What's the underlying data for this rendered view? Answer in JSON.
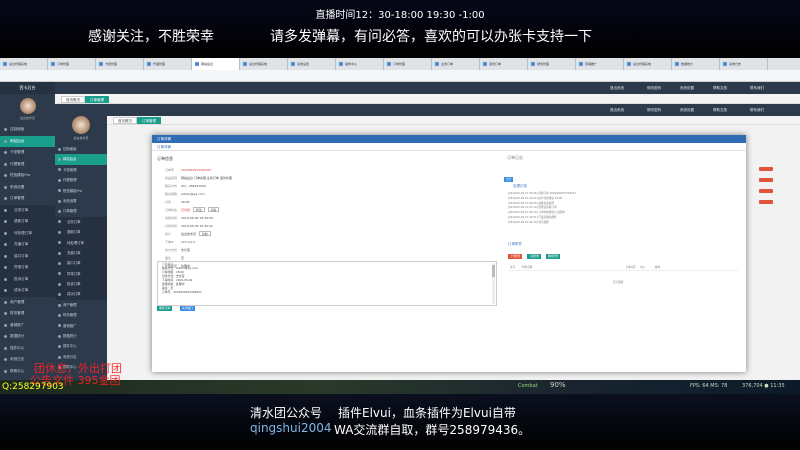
{
  "stream": {
    "live_time": "直播时间12：30-18:00   19:30 -1:00",
    "banner_left": "感谢关注，不胜荣幸",
    "banner_right": "请多发弹幕，有问必答，喜欢的可以办张卡支持一下",
    "footer_line1_left": "清水团公众号",
    "footer_line1_right": "插件Elvui，血条插件为Elvui自带",
    "footer_line2_left": "qingshui2004",
    "footer_line2_right": "WA交流群自取，群号258979436。",
    "qq": "Q:258297903",
    "overlay_red_1": "团休息，外出打团",
    "overlay_red_2": "公告文件    395金团"
  },
  "game": {
    "fps": "FPS: 64 MS: 78",
    "coords": "376,704 ● 11:35",
    "percent": "90%",
    "hint": "Combat"
  },
  "outer": {
    "brand": "西卡后台",
    "username": "后台技术员",
    "tabs": [
      "首页概况",
      "订单管理"
    ],
    "topbar": [
      "退出系统",
      "修改密码",
      "系统设置",
      "帮助文档",
      "联系我们"
    ],
    "menu": [
      {
        "label": "控制面板",
        "sub": false,
        "active": false
      },
      {
        "label": "网站后台",
        "sub": false,
        "active": true
      },
      {
        "label": "卡密管理",
        "sub": false,
        "active": false
      },
      {
        "label": "代理管理",
        "sub": false,
        "active": false
      },
      {
        "label": "短信模板Pro",
        "sub": false,
        "active": false
      },
      {
        "label": "系统设置",
        "sub": false,
        "active": false
      },
      {
        "label": "订单管理",
        "sub": false,
        "active": false
      },
      {
        "label": "业务订单",
        "sub": true,
        "active": false
      },
      {
        "label": "退款订单",
        "sub": true,
        "active": false
      },
      {
        "label": "待处理订单",
        "sub": true,
        "active": false
      },
      {
        "label": "充值订单",
        "sub": true,
        "active": false
      },
      {
        "label": "接口订单",
        "sub": true,
        "active": false
      },
      {
        "label": "异常订单",
        "sub": true,
        "active": false
      },
      {
        "label": "投诉订单",
        "sub": true,
        "active": false
      },
      {
        "label": "成功订单",
        "sub": true,
        "active": false
      },
      {
        "label": "商户管理",
        "sub": false,
        "active": false
      },
      {
        "label": "财务管理",
        "sub": false,
        "active": false
      },
      {
        "label": "营销推广",
        "sub": false,
        "active": false
      },
      {
        "label": "数据统计",
        "sub": false,
        "active": false
      },
      {
        "label": "插件中心",
        "sub": false,
        "active": false
      },
      {
        "label": "系统日志",
        "sub": false,
        "active": false
      },
      {
        "label": "帮助中心",
        "sub": false,
        "active": false
      }
    ]
  },
  "inner": {
    "username": "后台技术员",
    "tabs": [
      "首页概况",
      "订单管理"
    ],
    "topbar": [
      "退出系统",
      "修改密码",
      "系统设置",
      "帮助文档",
      "联系我们"
    ],
    "menu": [
      {
        "label": "控制面板",
        "sub": false,
        "active": false
      },
      {
        "label": "网站后台",
        "sub": false,
        "active": true
      },
      {
        "label": "卡密管理",
        "sub": false,
        "active": false
      },
      {
        "label": "代理管理",
        "sub": false,
        "active": false
      },
      {
        "label": "短信模板Pro",
        "sub": false,
        "active": false
      },
      {
        "label": "系统设置",
        "sub": false,
        "active": false
      },
      {
        "label": "订单管理",
        "sub": false,
        "active": false
      },
      {
        "label": "业务订单",
        "sub": true,
        "active": false
      },
      {
        "label": "退款订单",
        "sub": true,
        "active": false
      },
      {
        "label": "待处理订单",
        "sub": true,
        "active": false
      },
      {
        "label": "充值订单",
        "sub": true,
        "active": false
      },
      {
        "label": "接口订单",
        "sub": true,
        "active": false
      },
      {
        "label": "异常订单",
        "sub": true,
        "active": false
      },
      {
        "label": "投诉订单",
        "sub": true,
        "active": false
      },
      {
        "label": "成功订单",
        "sub": true,
        "active": false
      },
      {
        "label": "商户管理",
        "sub": false,
        "active": false
      },
      {
        "label": "财务管理",
        "sub": false,
        "active": false
      },
      {
        "label": "营销推广",
        "sub": false,
        "active": false
      },
      {
        "label": "数据统计",
        "sub": false,
        "active": false
      },
      {
        "label": "插件中心",
        "sub": false,
        "active": false
      },
      {
        "label": "系统日志",
        "sub": false,
        "active": false
      },
      {
        "label": "帮助中心",
        "sub": false,
        "active": false
      }
    ]
  },
  "browser_tabs": [
    "后台管理系统",
    "订单管理",
    "卡密管理",
    "代理管理",
    "网站后台",
    "后台管理系统",
    "系统设置",
    "插件中心",
    "订单管理",
    "业务订单",
    "退款订单",
    "财务管理",
    "营销推广",
    "后台管理系统",
    "数据统计",
    "系统日志"
  ],
  "modal": {
    "title": "订单详情",
    "subtab": "订单详情",
    "left_title": "订单信息",
    "fields": [
      {
        "label": "订单号",
        "value": "2019050915392657",
        "red": true
      },
      {
        "label": "商品名称",
        "value": "网站后台 订单处理 业务订单 退款处理",
        "red": false
      },
      {
        "label": "联系方式",
        "value": "QQ：258297903",
        "red": false
      },
      {
        "label": "联系邮箱",
        "value": "admin@qq.com",
        "red": false
      },
      {
        "label": "付款",
        "value": "18.00",
        "red": false
      },
      {
        "label": "订单状态",
        "value": "已付款",
        "red": true
      },
      {
        "label": "创建时间",
        "value": "2019-05-09 15:39:26",
        "red": false
      },
      {
        "label": "付款时间",
        "value": "2019-05-09 15:40:02",
        "red": false
      },
      {
        "label": "商户",
        "value": "后台技术员",
        "red": false
      },
      {
        "label": "下单IP",
        "value": "127.0.0.1",
        "red": false
      },
      {
        "label": "支付方式",
        "value": "支付宝",
        "red": false
      },
      {
        "label": "备注",
        "value": "无",
        "red": false
      },
      {
        "label": "处理结果",
        "value": "处理中",
        "red": false
      }
    ],
    "btn_edit": "修改",
    "btn_view": "查看",
    "btn_copy": "复制",
    "comments_label": "订单备注",
    "comments": [
      "联系方式：admin@qq.com",
      "订单金额：18.00",
      "付款方式：支付宝",
      "下单时间：2019-05-09",
      "处理状态：处理中",
      "备注：无",
      "订单号：2019050915392657"
    ],
    "btn_save": "保存订单",
    "btn_close": "关闭窗口",
    "right_title": "订单日志",
    "right_badge": "日志",
    "right_sub": "处理记录",
    "logs": [
      "[2019-05-09 15:39:26] 创建订单 2019050915392657",
      "[2019-05-09 15:40:02] 用户付款成功 18.00",
      "[2019-05-09 15:40:05] 系统自动处理",
      "[2019-05-09 15:41:10] 管理员查看订单",
      "[2019-05-09 15:42:33] 订单状态修改为 处理中",
      "[2019-05-09 15:43:01] 已发送通知邮件",
      "[2019-05-09 15:44:20] 等待处理"
    ],
    "attach_title": "订单附件",
    "attach_btns": [
      "上传附件",
      "下载附件",
      "删除附件"
    ],
    "attach_cols": [
      "序号",
      "附件名称",
      "上传时间",
      "大小",
      "操作"
    ],
    "attach_empty": "暂无数据"
  }
}
